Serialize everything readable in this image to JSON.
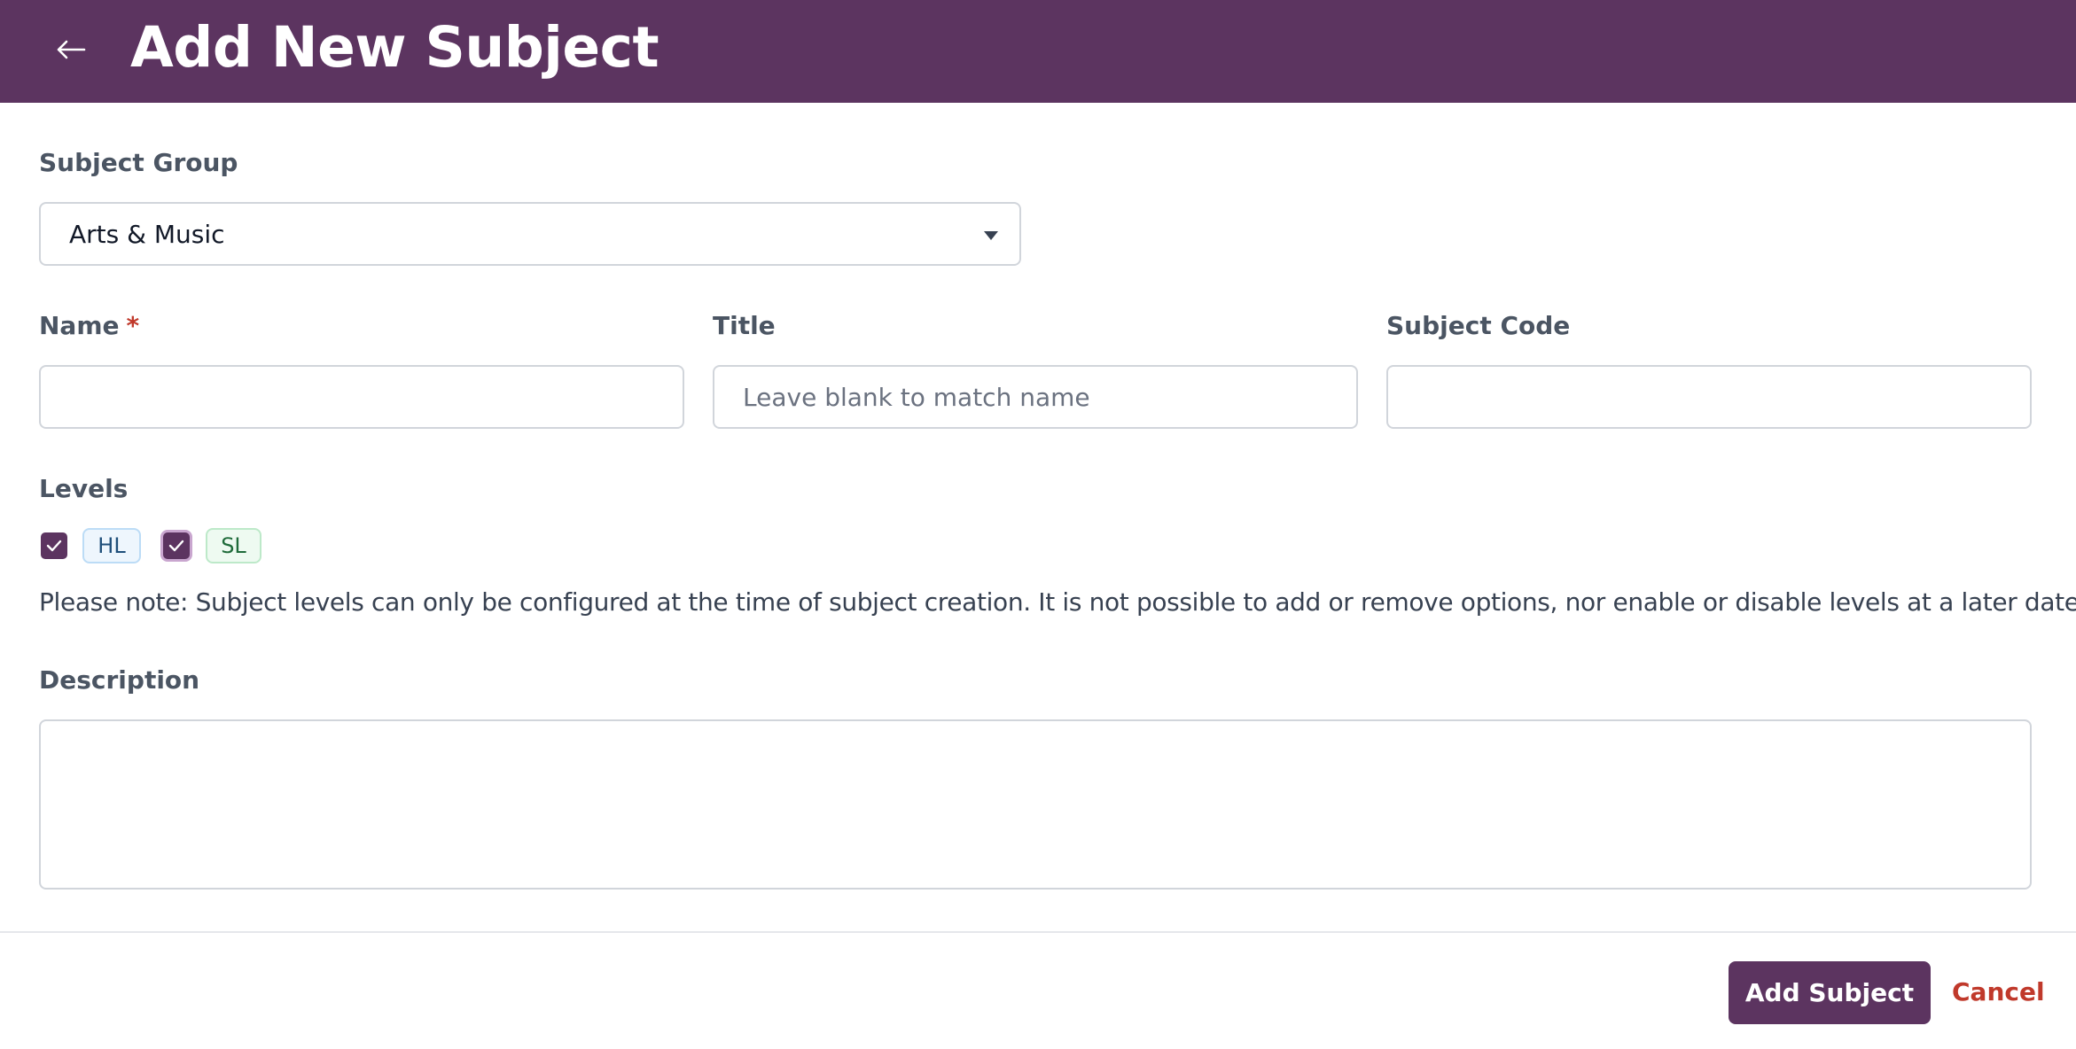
{
  "header": {
    "title": "Add New Subject",
    "back_icon": "arrow-left-icon"
  },
  "form": {
    "subject_group": {
      "label": "Subject Group",
      "selected": "Arts & Music"
    },
    "name": {
      "label": "Name",
      "required_marker": "*",
      "value": ""
    },
    "title": {
      "label": "Title",
      "value": "",
      "placeholder": "Leave blank to match name"
    },
    "subject_code": {
      "label": "Subject Code",
      "value": ""
    },
    "levels": {
      "label": "Levels",
      "options": [
        {
          "label": "HL",
          "checked": true
        },
        {
          "label": "SL",
          "checked": true
        }
      ],
      "note": "Please note: Subject levels can only be configured at the time of subject creation. It is not possible to add or remove options, nor enable or disable levels at a later date"
    },
    "description": {
      "label": "Description",
      "value": ""
    }
  },
  "actions": {
    "submit_label": "Add Subject",
    "cancel_label": "Cancel"
  },
  "colors": {
    "brand": "#5c3460",
    "danger": "#c0392b"
  }
}
